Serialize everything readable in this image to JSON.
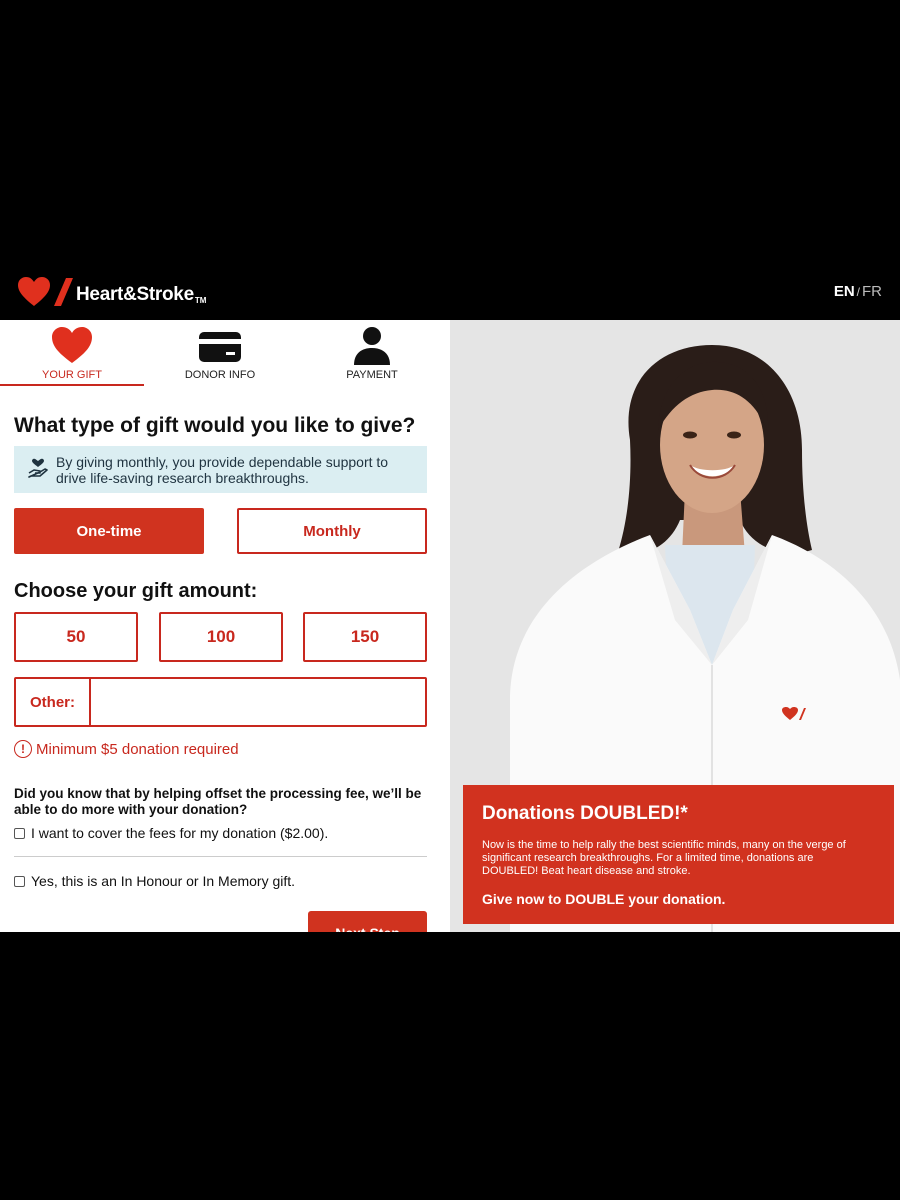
{
  "header": {
    "brand": "Heart&Stroke",
    "tm": "TM",
    "lang_en": "EN",
    "lang_sep": "/",
    "lang_fr": "FR"
  },
  "steps": [
    {
      "label": "YOUR GIFT",
      "icon": "heart-icon",
      "active": true
    },
    {
      "label": "DONOR INFO",
      "icon": "credit-card-icon",
      "active": false
    },
    {
      "label": "PAYMENT",
      "icon": "person-icon",
      "active": false
    }
  ],
  "gift": {
    "heading": "What type of gift would you like to give?",
    "info_text": "By giving monthly, you provide dependable support to drive life-saving research breakthroughs.",
    "one_time_label": "One-time",
    "monthly_label": "Monthly",
    "selected_type": "One-time"
  },
  "amount": {
    "heading": "Choose your gift amount:",
    "options": [
      "50",
      "100",
      "150"
    ],
    "other_label": "Other:",
    "other_value": "",
    "error": "Minimum $5 donation required"
  },
  "fees": {
    "question": "Did you know that by helping offset the processing fee, we’ll be able to do more with your donation?",
    "cover_fees_label": "I want to cover the fees for my donation ($2.00).",
    "tribute_label": "Yes, this is an In Honour or In Memory gift."
  },
  "next_label": "Next Step",
  "promo": {
    "title": "Donations DOUBLED!*",
    "body": "Now is the time to help rally the best scientific minds, many on the verge of significant research breakthroughs. For a limited time, donations are DOUBLED! Beat heart disease and stroke.",
    "cta": "Give now to DOUBLE your donation."
  },
  "colors": {
    "brand_red": "#d0331f",
    "info_bg": "#dbeef2"
  }
}
